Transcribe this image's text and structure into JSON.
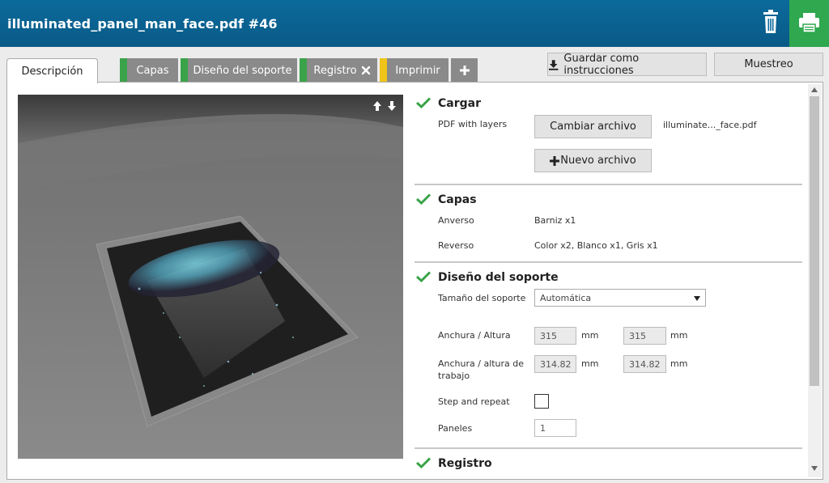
{
  "header": {
    "title": "illuminated_panel_man_face.pdf #46",
    "trash_icon": "trash-icon",
    "print_icon": "printer-icon"
  },
  "colors": {
    "header": "#0b6a9c",
    "print": "#2fa84f",
    "status_green": "#3aa34a",
    "status_yellow": "#f0c419",
    "tab_grey": "#8a8a8a",
    "check": "#3aa34a"
  },
  "tabs": [
    {
      "label": "Descripción",
      "active": true
    },
    {
      "label": "Capas",
      "status": "green"
    },
    {
      "label": "Diseño del soporte",
      "status": "green"
    },
    {
      "label": "Registro",
      "status": "green",
      "icon": "close-icon"
    },
    {
      "label": "Imprimir",
      "status": "yellow"
    },
    {
      "label": "+",
      "icon": "plus-icon"
    }
  ],
  "actions": {
    "save_label": "Guardar como instrucciones",
    "save_icon": "download-icon",
    "sample_label": "Muestreo"
  },
  "preview": {
    "icons": [
      "arrow-up-icon",
      "arrow-down-icon"
    ]
  },
  "load": {
    "title": "Cargar",
    "type_label": "PDF with layers",
    "change_file": "Cambiar archivo",
    "file_name": "illuminate..._face.pdf",
    "new_file": "Nuevo archivo"
  },
  "layers": {
    "title": "Capas",
    "front_label": "Anverso",
    "front_value": "Barniz x1",
    "back_label": "Reverso",
    "back_value": "Color x2, Blanco x1, Gris x1"
  },
  "media": {
    "title": "Diseño del soporte",
    "size_label": "Tamaño del soporte",
    "size_value": "Automática",
    "wh_label": "Anchura / Altura",
    "width": "315",
    "height": "315",
    "unit": "mm",
    "work_label": "Anchura / altura de trabajo",
    "work_width": "314.82",
    "work_height": "314.82",
    "step_label": "Step and repeat",
    "step_checked": false,
    "panels_label": "Paneles",
    "panels": "1"
  },
  "registration": {
    "title": "Registro"
  }
}
